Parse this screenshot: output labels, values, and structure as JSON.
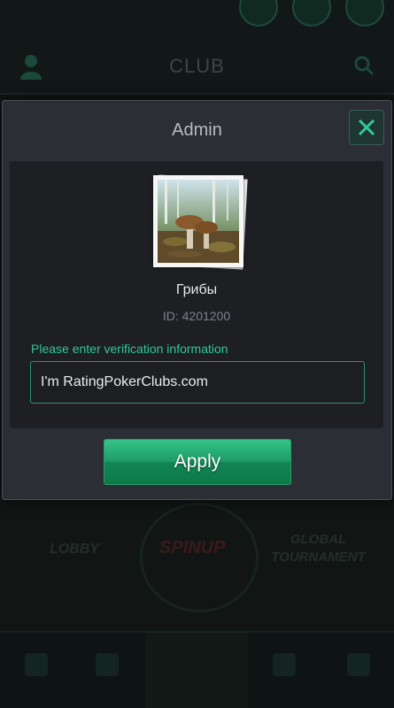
{
  "background": {
    "title": "CLUB",
    "lobby_label": "LOBBY",
    "spin_label": "SPINUP",
    "global_label": "GLOBAL TOURNAMENT"
  },
  "dialog": {
    "title": "Admin",
    "club_name": "Грибы",
    "club_id": "ID: 4201200",
    "verify_label": "Please enter verification information",
    "verify_value": "I'm RatingPokerClubs.com",
    "apply_label": "Apply"
  },
  "colors": {
    "accent": "#30c895",
    "apply_button": "#1e9d66",
    "dialog_bg": "#2b2e34"
  }
}
